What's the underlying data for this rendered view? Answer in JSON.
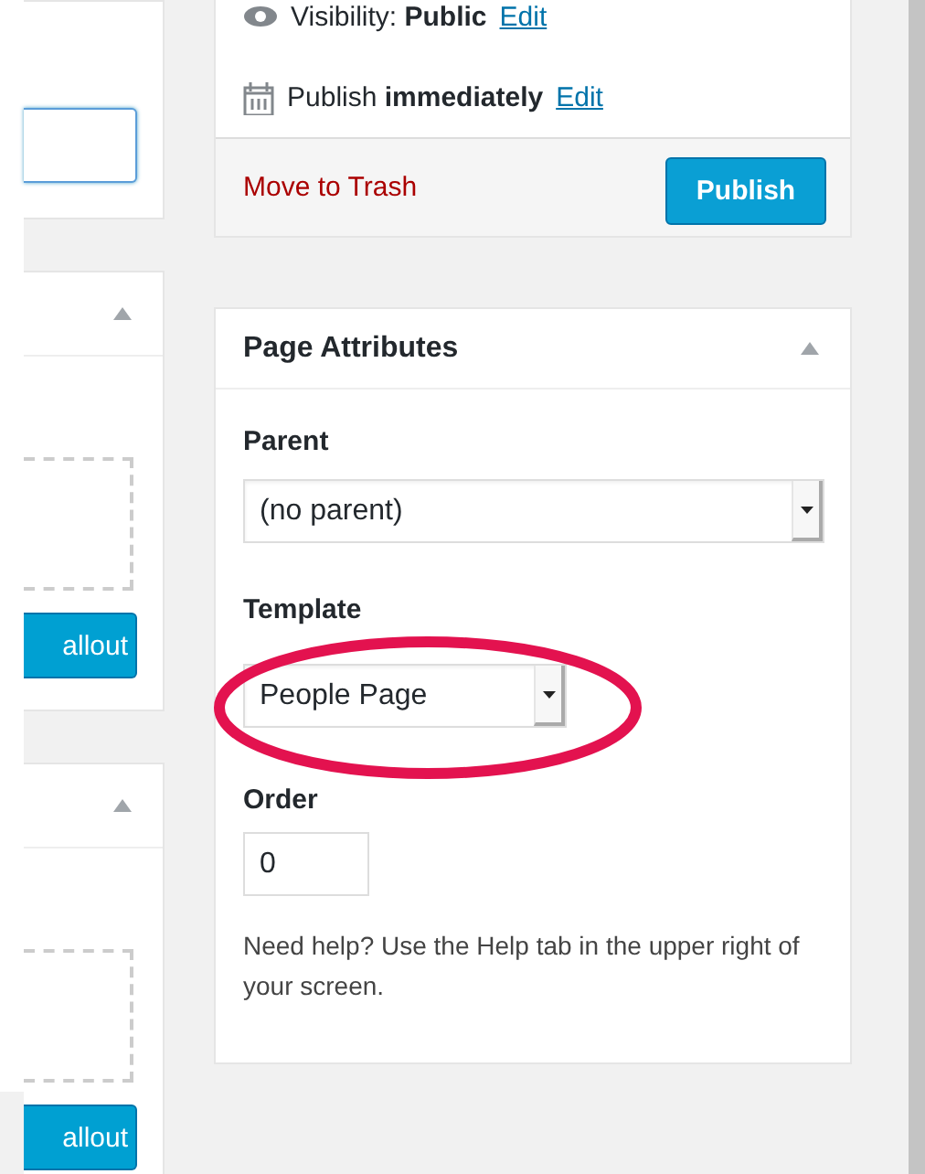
{
  "left_boxes": [
    {
      "kind": "field"
    },
    {
      "kind": "dropzone",
      "button": "allout"
    },
    {
      "kind": "dropzone",
      "button": "allout"
    }
  ],
  "publish_box": {
    "visibility_label": "Visibility:",
    "visibility_value": "Public",
    "visibility_edit": "Edit",
    "schedule_label": "Publish",
    "schedule_value": "immediately",
    "schedule_edit": "Edit",
    "trash_link": "Move to Trash",
    "publish_button": "Publish"
  },
  "page_attributes": {
    "title": "Page Attributes",
    "parent_label": "Parent",
    "parent_value": "(no parent)",
    "template_label": "Template",
    "template_value": "People Page",
    "order_label": "Order",
    "order_value": "0",
    "help": "Need help? Use the Help tab in the upper right of your screen."
  }
}
